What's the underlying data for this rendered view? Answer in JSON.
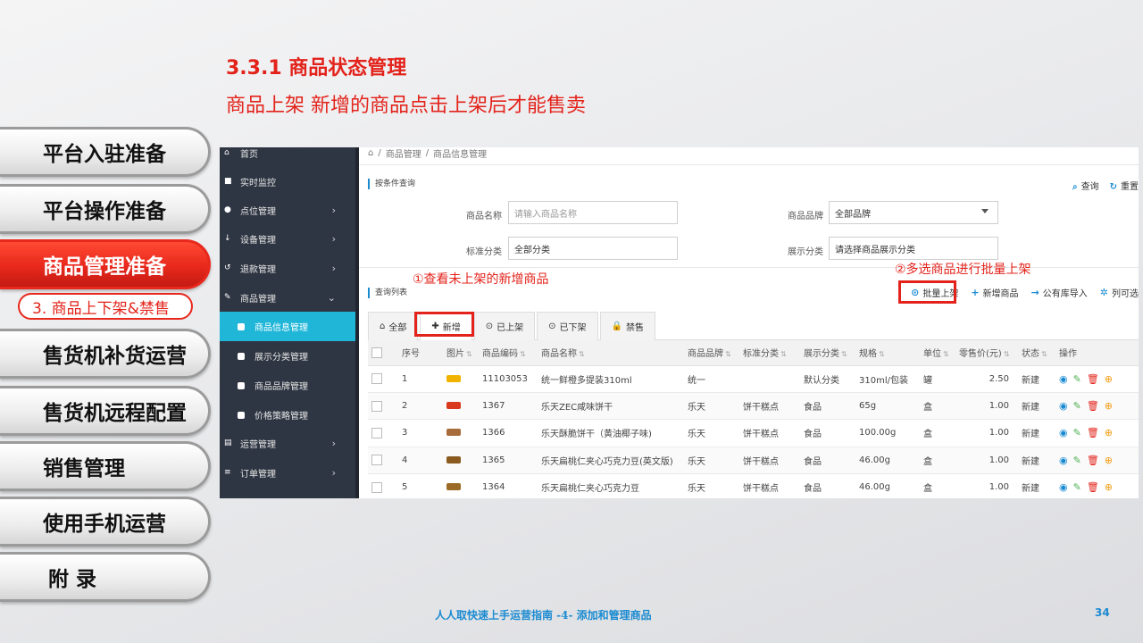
{
  "slide": {
    "title": "3.3.1 商品状态管理",
    "subtitle": "商品上架  新增的商品点击上架后才能售卖",
    "footer": "人人取快速上手运营指南 -4- 添加和管理商品",
    "page_number": "34"
  },
  "chapters": [
    {
      "label": "平台入驻准备"
    },
    {
      "label": "平台操作准备"
    },
    {
      "label": "商品管理准备"
    },
    {
      "label": "售货机补货运营"
    },
    {
      "label": "售货机远程配置"
    },
    {
      "label": "销售管理"
    },
    {
      "label": "使用手机运营"
    },
    {
      "label": "附  录"
    }
  ],
  "chapter_sub": "3. 商品上下架&禁售",
  "sidebar": {
    "items": [
      {
        "label": "首页",
        "icon": "home-icon",
        "glyph": "⌂"
      },
      {
        "label": "实时监控",
        "icon": "video-icon",
        "glyph": "■"
      },
      {
        "label": "点位管理",
        "icon": "map-marker-icon",
        "glyph": "●"
      },
      {
        "label": "设备管理",
        "icon": "sort-icon",
        "glyph": "↓"
      },
      {
        "label": "退款管理",
        "icon": "refund-icon",
        "glyph": "↺"
      },
      {
        "label": "商品管理",
        "icon": "edit-icon",
        "glyph": "✎"
      }
    ],
    "subitems": [
      {
        "label": "商品信息管理"
      },
      {
        "label": "展示分类管理"
      },
      {
        "label": "商品品牌管理"
      },
      {
        "label": "价格策略管理"
      }
    ],
    "items2": [
      {
        "label": "运营管理",
        "icon": "book-icon",
        "glyph": "▤"
      },
      {
        "label": "订单管理",
        "icon": "list-icon",
        "glyph": "≡"
      }
    ]
  },
  "breadcrumb": [
    "商品管理",
    "商品信息管理"
  ],
  "query": {
    "section_label": "按条件查询",
    "search_btn": "查询",
    "reset_btn": "重置",
    "name_label": "商品名称",
    "name_placeholder": "请输入商品名称",
    "brand_label": "商品品牌",
    "brand_value": "全部品牌",
    "std_label": "标准分类",
    "std_value": "全部分类",
    "disp_label": "展示分类",
    "disp_placeholder": "请选择商品展示分类"
  },
  "annotations": {
    "a1": "①查看未上架的新增商品",
    "a2": "②多选商品进行批量上架"
  },
  "list": {
    "section_label": "查询列表",
    "toolbar": {
      "batch_up": "批量上架",
      "add": "新增商品",
      "import": "公有库导入",
      "columns": "列可选"
    },
    "tabs": [
      {
        "label": "全部",
        "glyph": "⌂"
      },
      {
        "label": "新增",
        "glyph": "✚"
      },
      {
        "label": "已上架",
        "glyph": "⊙"
      },
      {
        "label": "已下架",
        "glyph": "⊙"
      },
      {
        "label": "禁售",
        "glyph": "🔒"
      }
    ],
    "columns": [
      "序号",
      "图片",
      "商品编码",
      "商品名称",
      "商品品牌",
      "标准分类",
      "展示分类",
      "规格",
      "单位",
      "零售价(元)",
      "状态",
      "操作"
    ],
    "rows": [
      {
        "no": "1",
        "code": "11103053",
        "name": "统一鲜橙多提装310ml",
        "brand": "统一",
        "std": "",
        "disp": "默认分类",
        "spec": "310ml/包装",
        "unit": "罐",
        "price": "2.50",
        "status": "新建",
        "thumb_color": "#f0b400"
      },
      {
        "no": "2",
        "code": "1367",
        "name": "乐天ZEC咸味饼干",
        "brand": "乐天",
        "std": "饼干糕点",
        "disp": "食品",
        "spec": "65g",
        "unit": "盒",
        "price": "1.00",
        "status": "新建",
        "thumb_color": "#d9391c"
      },
      {
        "no": "3",
        "code": "1366",
        "name": "乐天酥脆饼干（黄油椰子味)",
        "brand": "乐天",
        "std": "饼干糕点",
        "disp": "食品",
        "spec": "100.00g",
        "unit": "盒",
        "price": "1.00",
        "status": "新建",
        "thumb_color": "#a86b3a"
      },
      {
        "no": "4",
        "code": "1365",
        "name": "乐天扁桃仁夹心巧克力豆(英文版)",
        "brand": "乐天",
        "std": "饼干糕点",
        "disp": "食品",
        "spec": "46.00g",
        "unit": "盒",
        "price": "1.00",
        "status": "新建",
        "thumb_color": "#8a5a1e"
      },
      {
        "no": "5",
        "code": "1364",
        "name": "乐天扁桃仁夹心巧克力豆",
        "brand": "乐天",
        "std": "饼干糕点",
        "disp": "食品",
        "spec": "46.00g",
        "unit": "盒",
        "price": "1.00",
        "status": "新建",
        "thumb_color": "#9b6a24"
      }
    ]
  }
}
